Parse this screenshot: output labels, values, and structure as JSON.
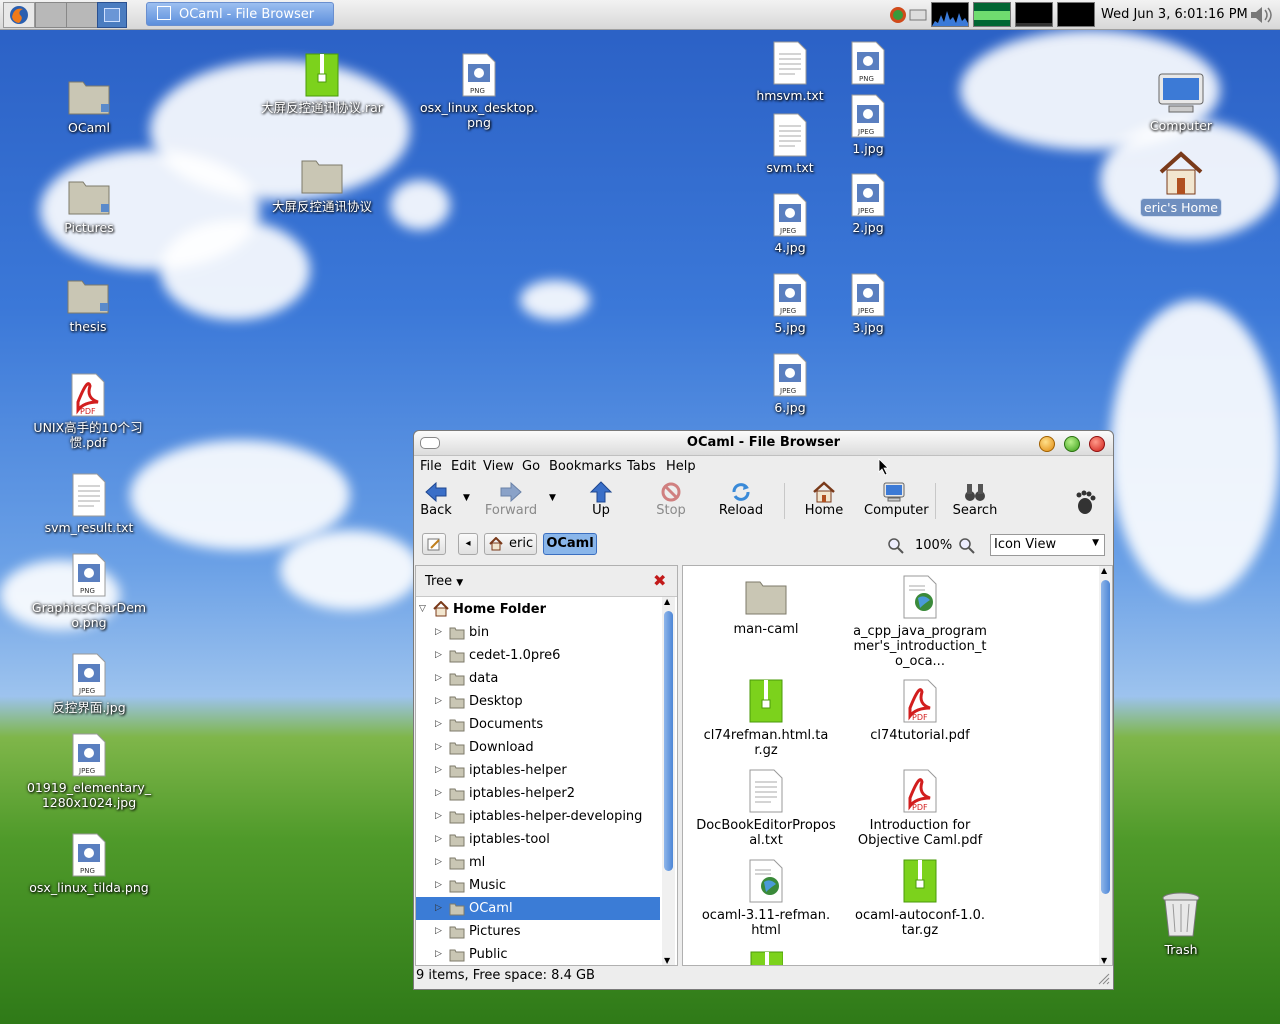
{
  "panel": {
    "task_title": "OCaml - File Browser",
    "clock": "Wed Jun  3,  6:01:16 PM"
  },
  "desktop": {
    "left_icons": [
      {
        "name": "OCaml",
        "type": "folder"
      },
      {
        "name": "Pictures",
        "type": "folder"
      },
      {
        "name": "thesis",
        "type": "folder"
      },
      {
        "name": "UNIX高手的10个习惯.pdf",
        "type": "pdf"
      },
      {
        "name": "svm_result.txt",
        "type": "text"
      },
      {
        "name": "GraphicsCharDemo.png",
        "type": "png"
      },
      {
        "name": "反控界面.jpg",
        "type": "jpeg"
      },
      {
        "name": "01919_elementary_1280x1024.jpg",
        "type": "jpeg"
      },
      {
        "name": "osx_linux_tilda.png",
        "type": "png"
      }
    ],
    "rar": "大屏反控通讯协议.rar",
    "folder2": "大屏反控通讯协议",
    "osx_desktop": "osx_linux_desktop.png",
    "col1": [
      "hmsvm.txt",
      "svm.txt",
      "4.jpg",
      "5.jpg",
      "6.jpg"
    ],
    "col2": [
      "1.jpg",
      "2.jpg",
      "3.jpg"
    ],
    "computer": "Computer",
    "home": "eric's Home",
    "trash": "Trash"
  },
  "window": {
    "title": "OCaml - File Browser",
    "menus": [
      "File",
      "Edit",
      "View",
      "Go",
      "Bookmarks",
      "Tabs",
      "Help"
    ],
    "toolbar": {
      "back": "Back",
      "forward": "Forward",
      "up": "Up",
      "stop": "Stop",
      "reload": "Reload",
      "home": "Home",
      "computer": "Computer",
      "search": "Search"
    },
    "location": {
      "parent": "eric",
      "current": "OCaml",
      "zoom": "100%",
      "view": "Icon View"
    },
    "sidebar": {
      "mode": "Tree",
      "root": "Home Folder",
      "items": [
        "bin",
        "cedet-1.0pre6",
        "data",
        "Desktop",
        "Documents",
        "Download",
        "iptables-helper",
        "iptables-helper2",
        "iptables-helper-developing",
        "iptables-tool",
        "ml",
        "Music",
        "OCaml",
        "Pictures",
        "Public"
      ],
      "selected": "OCaml"
    },
    "files": [
      {
        "name": "man-caml",
        "type": "folder"
      },
      {
        "name": "a_cpp_java_programmer's_introduction_to_oca...",
        "type": "html"
      },
      {
        "name": "cl74refman.html.tar.gz",
        "type": "archive"
      },
      {
        "name": "cl74tutorial.pdf",
        "type": "pdf"
      },
      {
        "name": "DocBookEditorProposal.txt",
        "type": "text"
      },
      {
        "name": "Introduction for Objective Caml.pdf",
        "type": "pdf"
      },
      {
        "name": "ocaml-3.11-refman.html",
        "type": "html"
      },
      {
        "name": "ocaml-autoconf-1.0.tar.gz",
        "type": "archive"
      }
    ],
    "status": "9 items, Free space: 8.4 GB"
  }
}
